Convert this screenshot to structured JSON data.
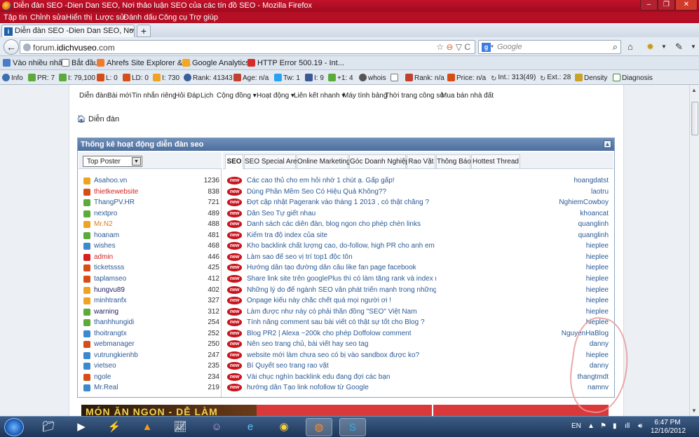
{
  "window": {
    "title": "Diễn đàn SEO -Dien Dan SEO, Nơi thảo luận SEO của các tín đồ SEO - Mozilla Firefox",
    "controls": [
      "–",
      "❐",
      "✕"
    ]
  },
  "menu": [
    "Tập tin",
    "Chỉnh sửa",
    "Hiển thị",
    "Lược sử",
    "Đánh dấu",
    "Công cụ",
    "Trợ giúp"
  ],
  "tab": {
    "label": "Diễn đàn SEO -Dien Dan SEO, Nơi thảo l...",
    "close": "×",
    "new": "+"
  },
  "nav": {
    "url_prefix": "forum.",
    "url_domain": "idichvuseo",
    "url_suffix": ".com",
    "search_placeholder": "Google",
    "search_engine_letter": "g"
  },
  "bookmarks": [
    {
      "label": "Vào nhiều nhất",
      "color": "#4a7cc8"
    },
    {
      "label": "Bắt đầu",
      "color": "#ffffff"
    },
    {
      "label": "Ahrefs Site Explorer & ...",
      "color": "#f07b2d"
    },
    {
      "label": "Google Analytics",
      "color": "#f5a623"
    },
    {
      "label": "HTTP Error 500.19 - Int...",
      "color": "#d62b2b"
    }
  ],
  "seobar": [
    {
      "label": "Info",
      "color": "#3c6fb0"
    },
    {
      "label": "PR: 7",
      "color": "#5bab3b"
    },
    {
      "label": "I: 79,100",
      "color": "#5bab3b"
    },
    {
      "label": "L: 0",
      "color": "#d64d17"
    },
    {
      "label": "LD: 0",
      "color": "#d64d17"
    },
    {
      "label": "I: 730",
      "color": "#f0a322"
    },
    {
      "label": "Rank: 41343",
      "color": "#3b5f9a"
    },
    {
      "label": "Age: n/a",
      "color": "#c2412d"
    },
    {
      "label": "Tw: 1",
      "color": "#2aa3ef"
    },
    {
      "label": "I: 9",
      "color": "#3b5998"
    },
    {
      "label": "+1: 4",
      "color": "#5bab3b"
    },
    {
      "label": "whois",
      "color": "#555555"
    },
    {
      "label": "",
      "color": "#777777"
    },
    {
      "label": "Rank: n/a",
      "color": "#c2412d"
    },
    {
      "label": "Price: n/a",
      "color": "#d64d17"
    },
    {
      "label": "Int.: 313(49)",
      "color": "#444444"
    },
    {
      "label": "Ext.: 28",
      "color": "#444444"
    },
    {
      "label": "Density",
      "color": "#c9a227"
    },
    {
      "label": "Diagnosis",
      "color": "#3a8a3a"
    }
  ],
  "forum_nav": [
    "Diễn đàn",
    "Bài mới",
    "Tin nhắn riêng",
    "Hỏi Đáp",
    "Lịch",
    "Cộng đồng ▾",
    "Hoạt động ▾",
    "Liên kết nhanh ▾",
    "Máy tính bảng",
    "Thời trang công sở",
    "Mua bán nhà đất"
  ],
  "breadcrumb": "Diễn đàn",
  "panel": {
    "title": "Thống kê hoạt động diễn đàn seo",
    "collapse_icon": "▲",
    "select_value": "Top Poster"
  },
  "top_posters": [
    {
      "name": "Asahoo.vn",
      "count": "1236",
      "color": "#2b5a95",
      "icon": "#f0a322"
    },
    {
      "name": "thietkewebsite",
      "count": "838",
      "color": "#d62020",
      "icon": "#d64d17"
    },
    {
      "name": "ThangPV.HR",
      "count": "721",
      "color": "#2b5a95",
      "icon": "#5bab3b"
    },
    {
      "name": "nextpro",
      "count": "489",
      "color": "#2b5a95",
      "icon": "#5bab3b"
    },
    {
      "name": "Mr.N2",
      "count": "488",
      "color": "#e07a1c",
      "icon": "#f0a322"
    },
    {
      "name": "hoanam",
      "count": "481",
      "color": "#2b5a95",
      "icon": "#5bab3b"
    },
    {
      "name": "wishes",
      "count": "468",
      "color": "#2b5a95",
      "icon": "#3a8ad0"
    },
    {
      "name": "admin",
      "count": "446",
      "color": "#d62020",
      "icon": "#d62020"
    },
    {
      "name": "ticketssss",
      "count": "425",
      "color": "#2b5a95",
      "icon": "#d64d17"
    },
    {
      "name": "taplamseo",
      "count": "412",
      "color": "#2b5a95",
      "icon": "#d64d17"
    },
    {
      "name": "hungvu89",
      "count": "402",
      "color": "#222266",
      "icon": "#f0a322"
    },
    {
      "name": "minhtranfx",
      "count": "327",
      "color": "#2b5a95",
      "icon": "#f0a322"
    },
    {
      "name": "warning",
      "count": "312",
      "color": "#222266",
      "icon": "#5bab3b"
    },
    {
      "name": "thanhhungidi",
      "count": "254",
      "color": "#2b5a95",
      "icon": "#5bab3b"
    },
    {
      "name": "thoitrangtx",
      "count": "252",
      "color": "#2b5a95",
      "icon": "#3a8ad0"
    },
    {
      "name": "webmanager",
      "count": "250",
      "color": "#2b5a95",
      "icon": "#d64d17"
    },
    {
      "name": "vutrungkienhb",
      "count": "247",
      "color": "#2b5a95",
      "icon": "#3a8ad0"
    },
    {
      "name": "vietseo",
      "count": "235",
      "color": "#2b5a95",
      "icon": "#3a8ad0"
    },
    {
      "name": "ngole",
      "count": "234",
      "color": "#2b5a95",
      "icon": "#d64d17"
    },
    {
      "name": "Mr.Real",
      "count": "219",
      "color": "#2b5a95",
      "icon": "#3a8ad0"
    }
  ],
  "tabs": [
    "SEO",
    "SEO Special Area",
    "Online Marketing",
    "Góc Doanh Nghiệp",
    "Rao Vặt",
    "Thông Báo",
    "Hottest Thread"
  ],
  "new_badge": "new",
  "threads": [
    {
      "title": "Các cao thủ cho em hỏi nhờ 1 chút ạ. Gấp gấp!",
      "user": "hoangdatst"
    },
    {
      "title": "Dùng Phần Mềm Seo Có Hiệu Quả Không??",
      "user": "laotru"
    },
    {
      "title": "Đợt cập nhật Pagerank vào tháng 1 2013 , có thật chăng ?",
      "user": "NghiemCowboy"
    },
    {
      "title": "Dân Seo Tự giết nhau",
      "user": "khoancat"
    },
    {
      "title": "Danh sách các diễn đàn, blog ngon cho phép chèn links",
      "user": "quanglinh"
    },
    {
      "title": "Kiểm tra độ index của site",
      "user": "quanglinh"
    },
    {
      "title": "Kho backlink chất lượng cao, do-follow, high PR cho anh em nào cần",
      "user": "hieplee"
    },
    {
      "title": "Làm sao để seo vị trí top1 độc tôn",
      "user": "hieplee"
    },
    {
      "title": "Hướng dẫn tạo đường dẫn câu like fan page facebook",
      "user": "hieplee"
    },
    {
      "title": "Share link site trên googlePlus thì có làm tăng rank và index nhanh...",
      "user": "hieplee"
    },
    {
      "title": "Những lý do để ngành SEO vẫn phát triển mạnh trong những năm tới",
      "user": "hieplee"
    },
    {
      "title": "Onpage kiểu này chắc chết quá mọi người ơi !",
      "user": "hieplee"
    },
    {
      "title": "Làm được như này có phải thần đồng \"SEO\" Việt Nam",
      "user": "hieplee"
    },
    {
      "title": "Tính năng comment sau bài viết có thật sự tốt cho Blog ?",
      "user": "hieplee"
    },
    {
      "title": "Blog PR2 | Alexa ~200k cho phép Doffolow comment",
      "user": "NguyenHaBlog"
    },
    {
      "title": "Nên seo trang chủ, bài viết hay seo tag",
      "user": "danny"
    },
    {
      "title": "website mới làm chưa seo có bị vào sandbox được ko?",
      "user": "hieplee"
    },
    {
      "title": "Bí Quyết seo trang rao vặt",
      "user": "danny"
    },
    {
      "title": "Vài chục nghìn backlink edu đang đợi các bạn",
      "user": "thangtmdt"
    },
    {
      "title": "hướng dẫn Tạo link nofollow từ Google",
      "user": "namnv"
    }
  ],
  "banner_text": "MÓN ĂN NGON - DỄ LÀM",
  "taskbar": {
    "apps": [
      "explorer-icon",
      "media-player-icon",
      "winamp-icon",
      "vlc-icon",
      "chart-app-icon",
      "yahoo-messenger-icon",
      "internet-explorer-icon",
      "chrome-icon",
      "firefox-icon",
      "skype-icon"
    ],
    "lang": "EN",
    "time": "6:47 PM",
    "date": "12/16/2012"
  }
}
